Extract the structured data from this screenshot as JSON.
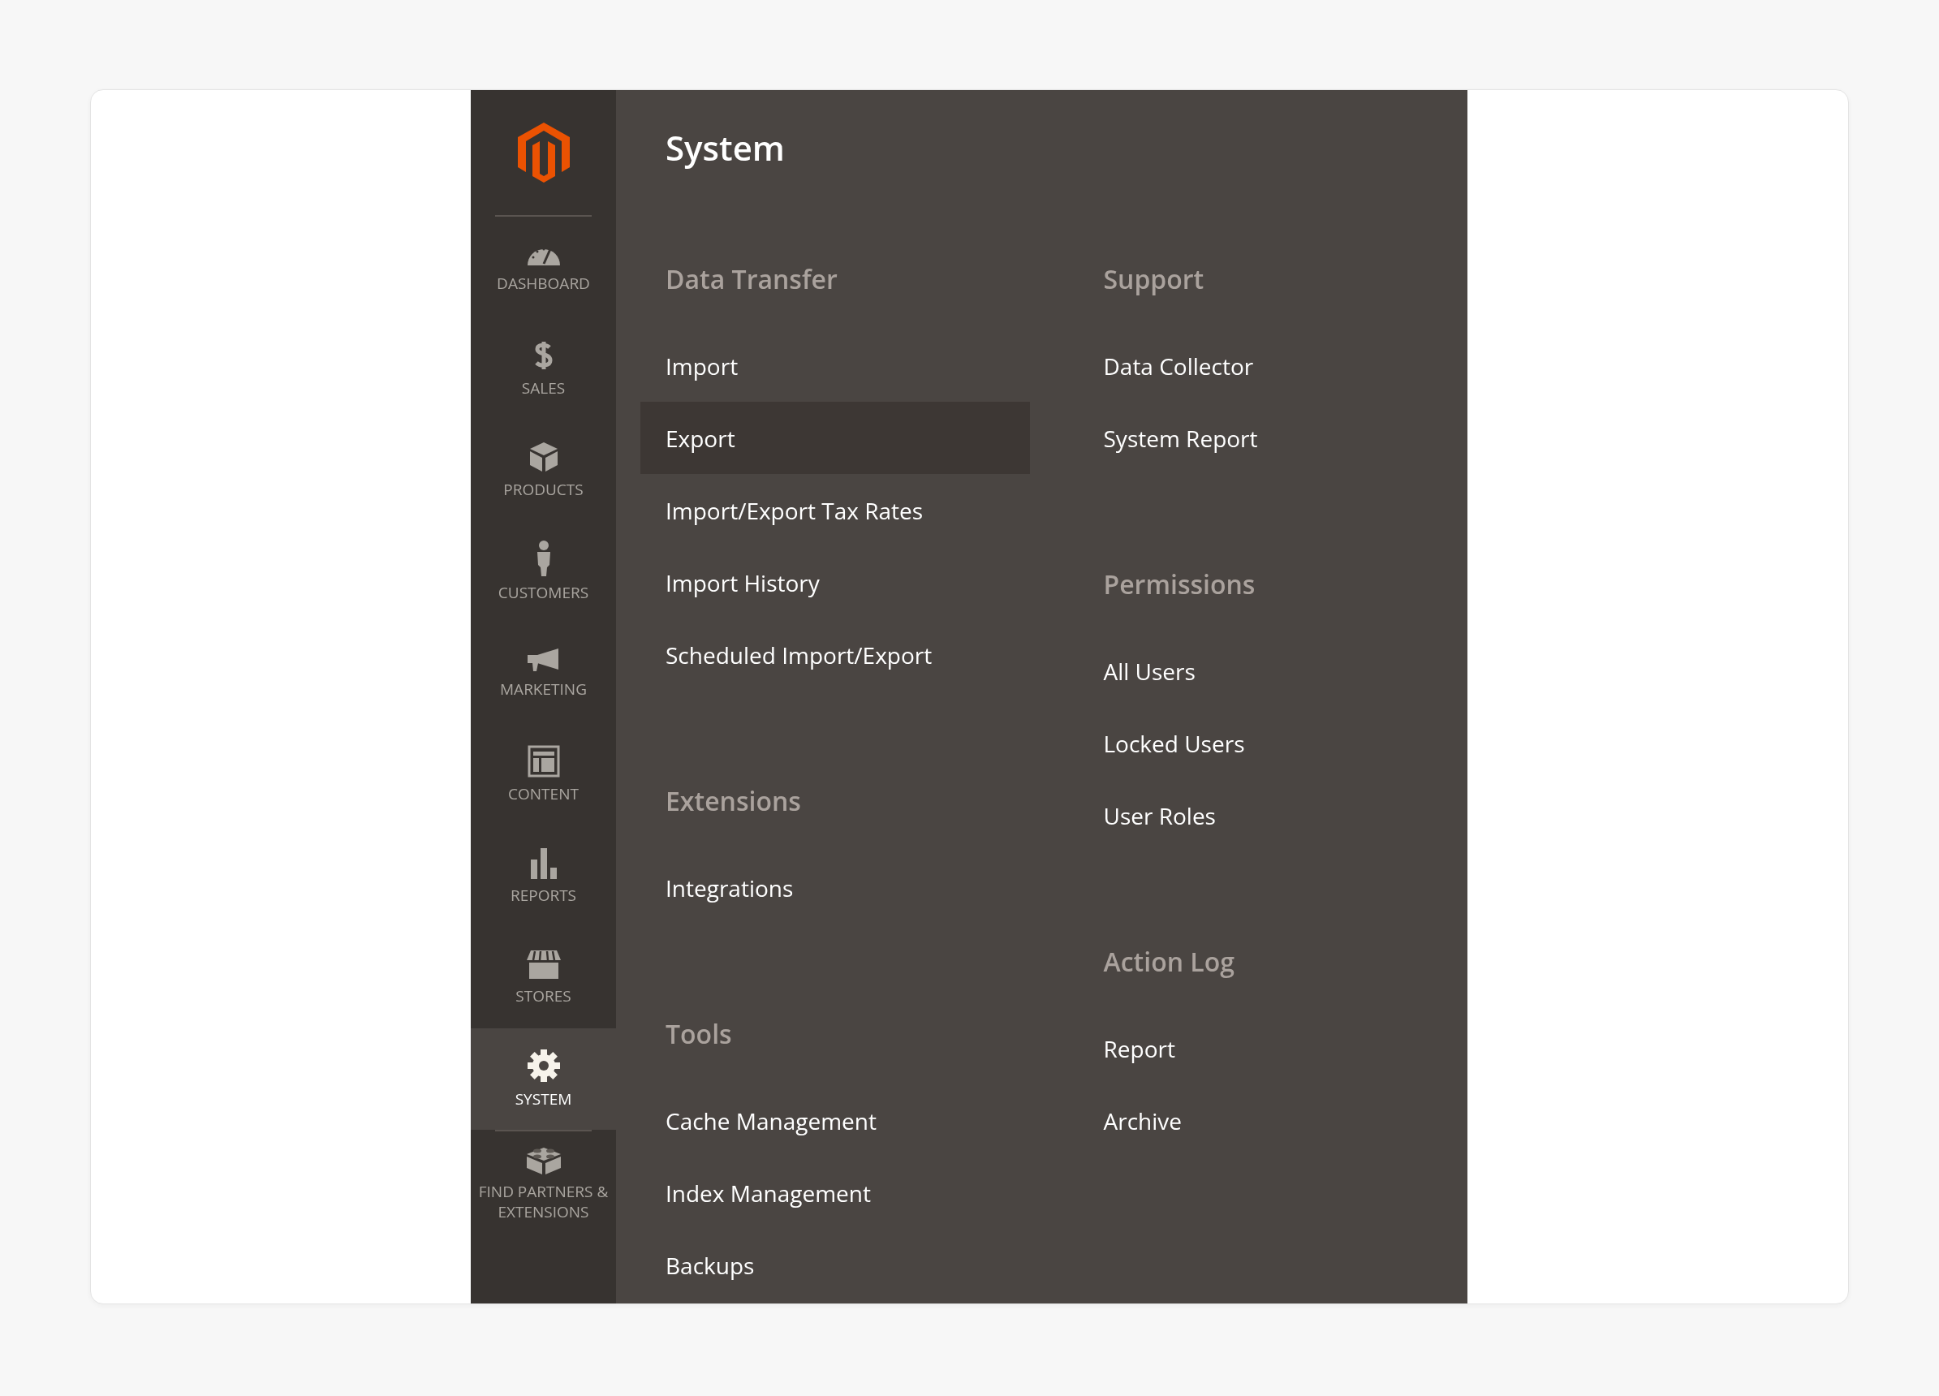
{
  "sidebar": {
    "items": [
      {
        "label": "DASHBOARD",
        "selected": false
      },
      {
        "label": "SALES",
        "selected": false
      },
      {
        "label": "PRODUCTS",
        "selected": false
      },
      {
        "label": "CUSTOMERS",
        "selected": false
      },
      {
        "label": "MARKETING",
        "selected": false
      },
      {
        "label": "CONTENT",
        "selected": false
      },
      {
        "label": "REPORTS",
        "selected": false
      },
      {
        "label": "STORES",
        "selected": false
      },
      {
        "label": "SYSTEM",
        "selected": true
      },
      {
        "label": "FIND PARTNERS & EXTENSIONS",
        "selected": false
      }
    ]
  },
  "menu": {
    "title": "System",
    "columns": [
      {
        "groups": [
          {
            "heading": "Data Transfer",
            "items": [
              {
                "label": "Import",
                "selected": false
              },
              {
                "label": "Export",
                "selected": true
              },
              {
                "label": "Import/Export Tax Rates",
                "selected": false
              },
              {
                "label": "Import History",
                "selected": false
              },
              {
                "label": "Scheduled Import/Export",
                "selected": false
              }
            ]
          },
          {
            "heading": "Extensions",
            "items": [
              {
                "label": "Integrations",
                "selected": false
              }
            ]
          },
          {
            "heading": "Tools",
            "items": [
              {
                "label": "Cache Management",
                "selected": false
              },
              {
                "label": "Index Management",
                "selected": false
              },
              {
                "label": "Backups",
                "selected": false
              }
            ]
          }
        ]
      },
      {
        "groups": [
          {
            "heading": "Support",
            "items": [
              {
                "label": "Data Collector",
                "selected": false
              },
              {
                "label": "System Report",
                "selected": false
              }
            ]
          },
          {
            "heading": "Permissions",
            "items": [
              {
                "label": "All Users",
                "selected": false
              },
              {
                "label": "Locked Users",
                "selected": false
              },
              {
                "label": "User Roles",
                "selected": false
              }
            ]
          },
          {
            "heading": "Action Log",
            "items": [
              {
                "label": "Report",
                "selected": false
              },
              {
                "label": "Archive",
                "selected": false
              }
            ]
          }
        ]
      }
    ]
  }
}
